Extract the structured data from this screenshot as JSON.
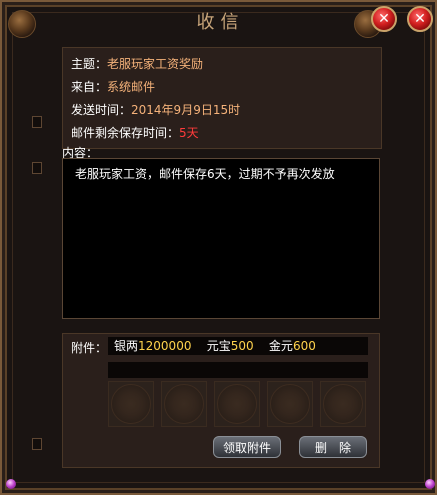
{
  "window": {
    "title": "收信"
  },
  "mail": {
    "subject_label": "主题：",
    "subject_value": "老服玩家工资奖励",
    "from_label": "来自：",
    "from_value": "系统邮件",
    "sent_label": "发送时间：",
    "sent_value": "2014年9月9日15时",
    "retention_label": "邮件剩余保存时间：",
    "retention_value": "5天",
    "content_label": "内容：",
    "content_text": "老服玩家工资，邮件保存6天，过期不予再次发放"
  },
  "attachment": {
    "label": "附件：",
    "silver_label": "银两",
    "silver_value": "1200000",
    "yuanbao_label": "元宝",
    "yuanbao_value": "500",
    "gold_label": "金元",
    "gold_value": "600"
  },
  "buttons": {
    "claim_label": "领取附件",
    "delete_label": "删　除"
  },
  "icons": {
    "close": "close-icon"
  },
  "colors": {
    "accent": "#f5b27a",
    "warning": "#ff3b3b",
    "money": "#ffd34d"
  }
}
